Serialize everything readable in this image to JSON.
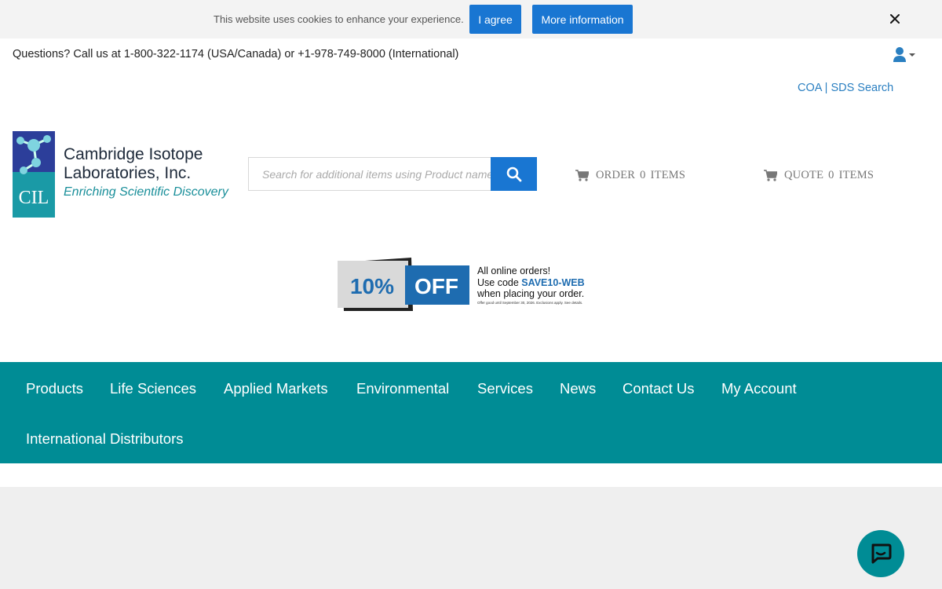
{
  "cookie_bar": {
    "message": "This website uses cookies to enhance your experience.",
    "agree_label": "I agree",
    "more_label": "More information",
    "close_icon": "close-icon"
  },
  "header": {
    "phone_text": "Questions? Call us at 1-800-322-1174 (USA/Canada) or +1-978-749-8000 (International)",
    "user_icon": "user-icon",
    "coa_link": "COA | SDS Search"
  },
  "logo": {
    "mark": "CIL",
    "name_line1": "Cambridge Isotope",
    "name_line2": "Laboratories, Inc.",
    "tagline": "Enriching Scientific Discovery"
  },
  "search": {
    "placeholder": "Search for additional items using Product name",
    "button_icon": "search-icon"
  },
  "carts": {
    "order_label": "ORDER",
    "order_count": "0",
    "order_suffix": "ITEMS",
    "quote_label": "QUOTE",
    "quote_count": "0",
    "quote_suffix": "ITEMS"
  },
  "promo": {
    "percent": "10%",
    "off": "OFF",
    "line1": "All online orders!",
    "line2_prefix": "Use code ",
    "code": "SAVE10-WEB",
    "line3": "when placing your order.",
    "fine_print": "Offer good until September 30, 2026. Exclusions apply. See details."
  },
  "nav": {
    "items": [
      "Products",
      "Life Sciences",
      "Applied Markets",
      "Environmental",
      "Services",
      "News",
      "Contact Us",
      "My Account",
      "International Distributors"
    ]
  },
  "chat": {
    "icon": "chat-icon"
  },
  "colors": {
    "brand_teal": "#008c95",
    "button_blue": "#1976d2",
    "link_blue": "#2a7fc1"
  }
}
